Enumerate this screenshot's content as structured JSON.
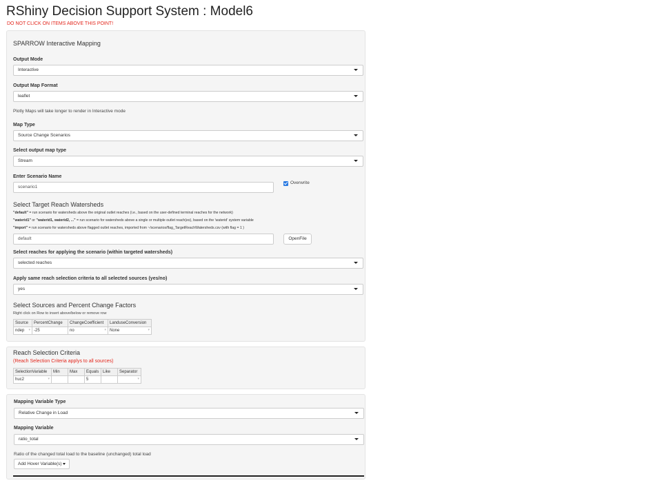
{
  "header": {
    "title": "RShiny Decision Support System : Model6",
    "warning": "DO NOT CLICK ON ITEMS ABOVE THIS POINT!"
  },
  "mapping_panel": {
    "title": "SPARROW Interactive Mapping",
    "output_mode": {
      "label": "Output Mode",
      "value": "Interactive"
    },
    "output_map_format": {
      "label": "Output Map Format",
      "value": "leaflet"
    },
    "plotly_note": "Plotly Maps will take longer to render in Interactive mode",
    "map_type": {
      "label": "Map Type",
      "value": "Source Change Scenarios"
    },
    "output_map_type": {
      "label": "Select output map type",
      "value": "Stream"
    },
    "scenario_name": {
      "label": "Enter Scenario Name",
      "value": "scenario1"
    },
    "overwrite": {
      "label": "Overwrite",
      "checked": true
    },
    "target_watersheds": {
      "title": "Select Target Reach Watersheds",
      "notes": [
        {
          "key": "\"default\"",
          "text": " = run scenario for watersheds above the original outlet reaches (i.e., based on the user-defined terminal reaches for the network)"
        },
        {
          "key": "\"waterid1\"",
          "mid": " or ",
          "key2": "\"waterid1, waterid2, ...\"",
          "text": " = run scenario for watersheds above a single or multiple outlet reach(es), based on the 'waterid' system variable"
        },
        {
          "key": "\"import\"",
          "text": " = run scenario for watersheds above flagged outlet reaches, imported from ~/scenarios/flag_TargetReachWatersheds.csv (with flag = 1 )"
        }
      ],
      "value": "default",
      "openfile_label": "OpenFile"
    },
    "reaches_apply": {
      "label": "Select reaches for applying the scenario (within targeted watersheds)",
      "value": "selected reaches"
    },
    "same_criteria": {
      "label": "Apply same reach selection criteria to all selected sources (yes/no)",
      "value": "yes"
    },
    "sources": {
      "title": "Select Sources and Percent Change Factors",
      "help": "Right click on Row to insert above/below or remove row",
      "columns": [
        "Source",
        "PercentChange",
        "ChangeCoefficient",
        "LanduseConversion"
      ],
      "rows": [
        [
          "ndep",
          "-25",
          "no",
          "None"
        ]
      ]
    }
  },
  "reach_panel": {
    "title": "Reach Selection Criteria",
    "note": "(Reach Selection Criteria applys to all sources)",
    "columns": [
      "SelectionVariable",
      "Min",
      "Max",
      "Equals",
      "Like",
      "Separator"
    ],
    "rows": [
      [
        "huc2",
        "",
        "",
        "5",
        "",
        ""
      ]
    ]
  },
  "variable_panel": {
    "variable_type": {
      "label": "Mapping Variable Type",
      "value": "Relative Change in Load"
    },
    "variable": {
      "label": "Mapping Variable",
      "value": "ratio_total"
    },
    "description": "Ratio of the changed total load to the baseline (unchanged) total load",
    "hover_button": "Add Hover Variable(s)"
  },
  "icons": {
    "dropdown": "caret-down-icon",
    "checkbox": "checkbox-checked-icon"
  },
  "colors": {
    "warning": "#e3261c",
    "checkbox": "#2a7ae2",
    "panel_bg": "#f5f5f5"
  }
}
